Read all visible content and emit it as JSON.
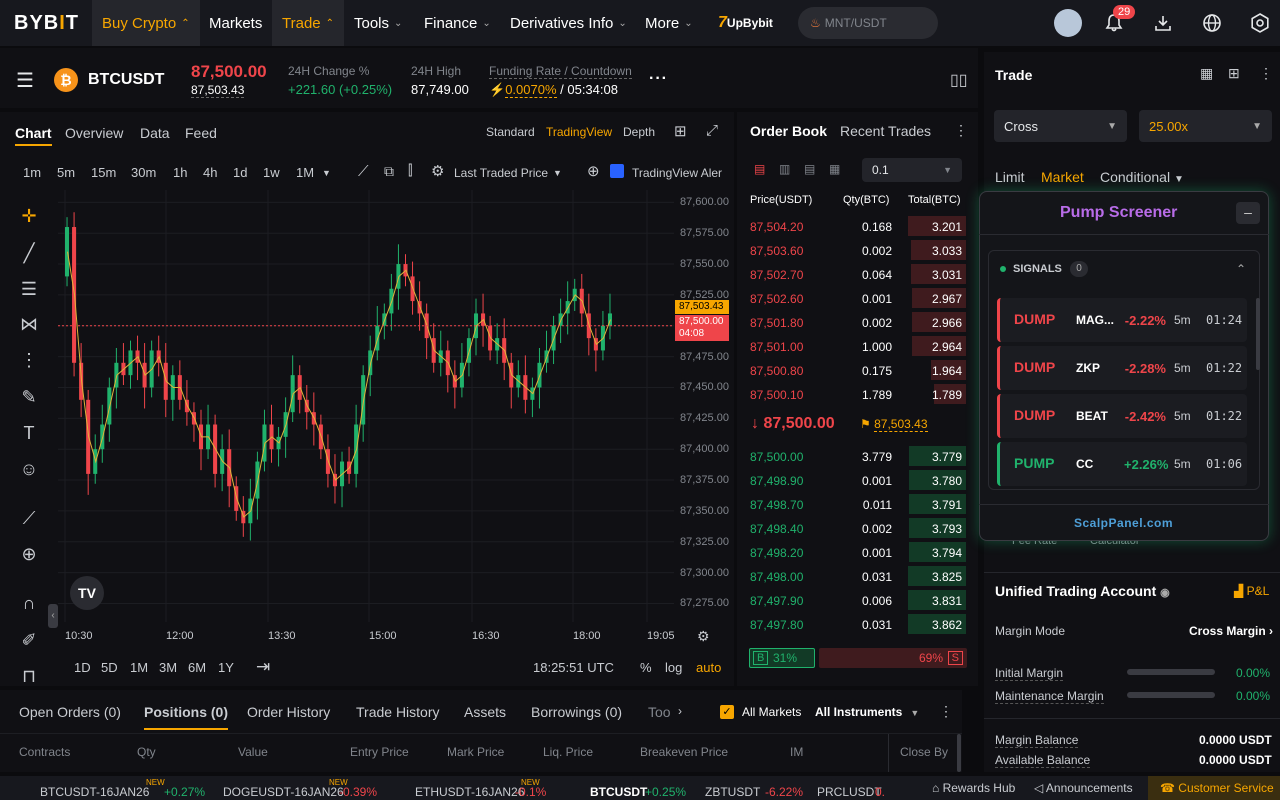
{
  "nav": {
    "logo_a": "BYB",
    "logo_b": "I",
    "logo_c": "T",
    "items": [
      {
        "label": "Buy Crypto",
        "chev": "^"
      },
      {
        "label": "Markets"
      },
      {
        "label": "Trade",
        "chev": "^"
      },
      {
        "label": "Tools",
        "chev": "v"
      },
      {
        "label": "Finance",
        "chev": "v"
      },
      {
        "label": "Derivatives Info",
        "chev": "v"
      },
      {
        "label": "More",
        "chev": "v"
      }
    ],
    "promo": "UpBybit",
    "promo_mark": "7",
    "search_placeholder": "MNT/USDT",
    "notifications": "29"
  },
  "ticker": {
    "symbol": "BTCUSDT",
    "coin_glyph": "₿",
    "last_price": "87,500.00",
    "mark_price": "87,503.43",
    "change_label": "24H Change %",
    "change_value": "+221.60 (+0.25%)",
    "high_label": "24H High",
    "high_value": "87,749.00",
    "funding_label": "Funding Rate / Countdown",
    "funding_rate": "0.0070%",
    "countdown": "/ 05:34:08"
  },
  "chart": {
    "tabs": [
      "Chart",
      "Overview",
      "Data",
      "Feed"
    ],
    "views": [
      "Standard",
      "TradingView",
      "Depth"
    ],
    "timeframes": [
      "1m",
      "5m",
      "15m",
      "30m",
      "1h",
      "4h",
      "1d",
      "1w",
      "1M"
    ],
    "price_source": "Last Traded Price",
    "alert_label": "TradingView Aler",
    "ranges": [
      "1D",
      "5D",
      "1M",
      "3M",
      "6M",
      "1Y"
    ],
    "clock": "18:25:51 UTC",
    "scale_opts": [
      "%",
      "log",
      "auto"
    ],
    "price_tag_mark": "87,503.43",
    "price_tag_last": "87,500.00",
    "price_tag_count": "04:08",
    "watermark": "TV"
  },
  "chart_data": {
    "type": "candlestick",
    "title": "",
    "xlabel": "",
    "ylabel": "",
    "x_ticks": [
      "10:30",
      "12:00",
      "13:30",
      "15:00",
      "16:30",
      "18:00",
      "19:05"
    ],
    "y_ticks": [
      "87,600.00",
      "87,575.00",
      "87,550.00",
      "87,525.00",
      "87,500.00",
      "87,475.00",
      "87,450.00",
      "87,425.00",
      "87,400.00",
      "87,375.00",
      "87,350.00",
      "87,325.00",
      "87,300.00",
      "87,275.00"
    ],
    "ylim": [
      87260,
      87610
    ],
    "interval": "5m",
    "close_series": [
      87580,
      87470,
      87440,
      87380,
      87400,
      87420,
      87450,
      87470,
      87460,
      87480,
      87470,
      87450,
      87480,
      87470,
      87440,
      87460,
      87440,
      87430,
      87420,
      87400,
      87420,
      87380,
      87400,
      87370,
      87350,
      87340,
      87360,
      87390,
      87420,
      87400,
      87410,
      87430,
      87460,
      87440,
      87430,
      87420,
      87400,
      87380,
      87370,
      87390,
      87380,
      87420,
      87460,
      87480,
      87500,
      87510,
      87530,
      87550,
      87540,
      87520,
      87510,
      87490,
      87470,
      87480,
      87460,
      87450,
      87470,
      87490,
      87510,
      87500,
      87480,
      87490,
      87470,
      87450,
      87460,
      87440,
      87450,
      87470,
      87480,
      87500,
      87510,
      87520,
      87530,
      87510,
      87490,
      87480,
      87500,
      87510
    ]
  },
  "orderbook": {
    "tabs": [
      "Order Book",
      "Recent Trades"
    ],
    "precision": "0.1",
    "headers": [
      "Price(USDT)",
      "Qty(BTC)",
      "Total(BTC)"
    ],
    "asks": [
      {
        "p": "87,504.20",
        "q": "0.168",
        "t": "3.201",
        "d": 1.0
      },
      {
        "p": "87,503.60",
        "q": "0.002",
        "t": "3.033",
        "d": 0.95
      },
      {
        "p": "87,502.70",
        "q": "0.064",
        "t": "3.031",
        "d": 0.95
      },
      {
        "p": "87,502.60",
        "q": "0.001",
        "t": "2.967",
        "d": 0.93
      },
      {
        "p": "87,501.80",
        "q": "0.002",
        "t": "2.966",
        "d": 0.93
      },
      {
        "p": "87,501.00",
        "q": "1.000",
        "t": "2.964",
        "d": 0.93
      },
      {
        "p": "87,500.80",
        "q": "0.175",
        "t": "1.964",
        "d": 0.61
      },
      {
        "p": "87,500.10",
        "q": "1.789",
        "t": "1.789",
        "d": 0.56
      }
    ],
    "last_price": "87,500.00",
    "mark_price": "87,503.43",
    "bids": [
      {
        "p": "87,500.00",
        "q": "3.779",
        "t": "3.779",
        "d": 0.98
      },
      {
        "p": "87,498.90",
        "q": "0.001",
        "t": "3.780",
        "d": 0.98
      },
      {
        "p": "87,498.70",
        "q": "0.011",
        "t": "3.791",
        "d": 0.98
      },
      {
        "p": "87,498.40",
        "q": "0.002",
        "t": "3.793",
        "d": 0.99
      },
      {
        "p": "87,498.20",
        "q": "0.001",
        "t": "3.794",
        "d": 0.99
      },
      {
        "p": "87,498.00",
        "q": "0.031",
        "t": "3.825",
        "d": 1.0
      },
      {
        "p": "87,497.90",
        "q": "0.006",
        "t": "3.831",
        "d": 1.0
      },
      {
        "p": "87,497.80",
        "q": "0.031",
        "t": "3.862",
        "d": 1.0
      }
    ],
    "buy_label": "B",
    "buy_pct": "31%",
    "sell_pct": "69%",
    "sell_label": "S",
    "buy_ratio": 0.31
  },
  "trade": {
    "title": "Trade",
    "margin": "Cross",
    "leverage": "25.00x",
    "types": [
      "Limit",
      "Market",
      "Conditional"
    ]
  },
  "screener": {
    "title": "Pump Screener",
    "signals_label": "SIGNALS",
    "signals_count": "0",
    "signals": [
      {
        "kind": "DUMP",
        "sym": "MAG...",
        "chg": "-2.22%",
        "tf": "5m",
        "time": "01:24"
      },
      {
        "kind": "DUMP",
        "sym": "ZKP",
        "chg": "-2.28%",
        "tf": "5m",
        "time": "01:22"
      },
      {
        "kind": "DUMP",
        "sym": "BEAT",
        "chg": "-2.42%",
        "tf": "5m",
        "time": "01:22"
      },
      {
        "kind": "PUMP",
        "sym": "CC",
        "chg": "+2.26%",
        "tf": "5m",
        "time": "01:06"
      }
    ],
    "footer": "ScalpPanel.com",
    "behind_a": "Fee Rate",
    "behind_b": "Calculator"
  },
  "account": {
    "title": "Unified Trading Account",
    "pnl": "P&L",
    "margin_mode_label": "Margin Mode",
    "margin_mode_value": "Cross Margin",
    "initial_label": "Initial Margin",
    "initial_value": "0.00%",
    "maint_label": "Maintenance Margin",
    "maint_value": "0.00%",
    "balance_label": "Margin Balance",
    "balance_value": "0.0000 USDT",
    "avail_label": "Available Balance",
    "avail_value": "0.0000 USDT"
  },
  "bottom": {
    "tabs": [
      "Open Orders (0)",
      "Positions (0)",
      "Order History",
      "Trade History",
      "Assets",
      "Borrowings (0)",
      "Too"
    ],
    "all_markets": "All Markets",
    "all_instruments": "All Instruments",
    "columns": [
      "Contracts",
      "Qty",
      "Value",
      "Entry Price",
      "Mark Price",
      "Liq. Price",
      "Breakeven Price",
      "IM",
      "Close By"
    ]
  },
  "marquee": {
    "items": [
      {
        "sym": "BTCUSDT-16JAN26",
        "chg": "+0.27%",
        "new": "NEW",
        "dir": "up"
      },
      {
        "sym": "DOGEUSDT-16JAN26",
        "chg": "-0.39%",
        "new": "NEW",
        "dir": "down"
      },
      {
        "sym": "ETHUSDT-16JAN26",
        "chg": "-0.1%",
        "new": "NEW",
        "dir": "down"
      },
      {
        "sym": "BTCUSDT",
        "chg": "+0.25%",
        "new": "",
        "dir": "up"
      },
      {
        "sym": "ZBTUSDT",
        "chg": "-6.22%",
        "new": "",
        "dir": "down"
      },
      {
        "sym": "PRCLUSDT",
        "chg": "0.",
        "new": "",
        "dir": "down"
      }
    ],
    "rewards": "Rewards Hub",
    "announcements": "Announcements",
    "support": "Customer Service"
  }
}
